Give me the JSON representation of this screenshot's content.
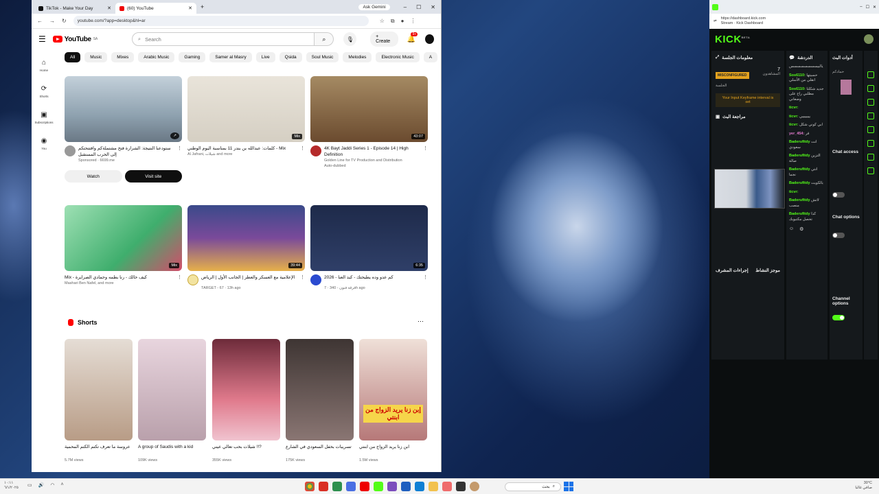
{
  "youtube": {
    "tabs": [
      {
        "label": "TikTok - Make Your Day"
      },
      {
        "label": "(60) YouTube"
      }
    ],
    "ask_gemini": "Ask Gemini",
    "url": "youtube.com/?app=desktop&hl=ar",
    "logo_text": "YouTube",
    "logo_sup": "SA",
    "search_placeholder": "Search",
    "create_label": "+ Create",
    "notif_badge": "9+",
    "sidebar": [
      {
        "label": "Home",
        "icon": "home-icon"
      },
      {
        "label": "Shorts",
        "icon": "shorts-icon"
      },
      {
        "label": "Subscriptions",
        "icon": "subscriptions-icon"
      },
      {
        "label": "You",
        "icon": "you-icon"
      }
    ],
    "chips": [
      "All",
      "Music",
      "Mixes",
      "Arabic Music",
      "Gaming",
      "Samer al Masry",
      "Live",
      "Qsida",
      "Soul Music",
      "Melodies",
      "Electronic Music",
      "A"
    ],
    "videos": [
      {
        "title": "ستودعنا النتيجة: الشرارة فتح مشتملةكم وافتتحتكم إلى الحرب المستقبل",
        "meta1": "Sponsored · 6699.me",
        "color": "#9fb3c4",
        "duration": ""
      },
      {
        "title": "كلمات: عبدالله بن بندر 11 بمناسبة اليوم الوطني - Mix",
        "meta1": "Al Jafrani, شيلات and more",
        "color": "#ece7de",
        "duration": "Mix"
      },
      {
        "title": "4K Bayt Jaddi Series 1 - Episode 14 | High Definition",
        "meta1": "Golden Line for TV Production and Distribution",
        "meta2": "Auto-dubbed",
        "color": "#7a5a3a",
        "duration": "43:07"
      },
      {
        "title": "Mix - كيف حالك - رنا بطمه وحمادي الصرايرة",
        "meta1": "Mashari Ben Nafel, and more",
        "color": "#6fc98e",
        "duration": "Mix"
      },
      {
        "title": "الإعلامية مع العسكر والعطر | الجانب الأول | الرياض",
        "meta1": "TARGET - 67 · 13h ago",
        "color": "#4e5a88",
        "duration": "39:44"
      },
      {
        "title": "كم عدو وده يطيحتك - كبد العنا - 2026",
        "meta1": "فرقة فنون - 340 · 7h ago",
        "color": "#2c3c63",
        "duration": "6:35"
      }
    ],
    "watch_label": "Watch",
    "visit_label": "Visit site",
    "shorts_title": "Shorts",
    "shorts": [
      {
        "title": "عروسة ما تعرف تكتم الكتم المحمية",
        "views": "5.7M views",
        "color": "#c9b7a8"
      },
      {
        "title": "A group of Saudis with a kid",
        "views": "109K views",
        "color": "#d8c6d1"
      },
      {
        "title": "شيلات بحب تعالي عيني !!?",
        "views": "355K views",
        "color": "#c86a7a"
      },
      {
        "title": "تسريبات بحفل السعودي في الشارع",
        "views": "175K views",
        "color": "#6d5d5a"
      },
      {
        "title": "ابن زنا يريد الزواج من ابنتي",
        "views": "1.5M views",
        "color": "#d8a0a0",
        "caption": "إبن زنا يريد الزواج من ابنتي"
      }
    ]
  },
  "kick": {
    "url": "https://dashboard.kick.com",
    "url_title": "Stream · Kick Dashboard",
    "logo": "KICK",
    "panels": {
      "session": "معلومات الجلسة",
      "chat": "الدردشة",
      "actions": "أدوات البث",
      "warning": "MISCONFIGURED",
      "viewers_count": "7",
      "viewers_label": "المشاهدون",
      "session_label": "الجلسة",
      "keyframe_msg": "Your Input Keyframe interval is set",
      "review": "مراجعة البث",
      "mod": "موجز النشاط",
      "mod2": "إجراءات المشرف"
    },
    "chat": [
      {
        "user": "",
        "text": "يالبيسسسسسسسس"
      },
      {
        "user": "Sos6110:",
        "text": "حسيتها انقلي من الأسلي"
      },
      {
        "user": "Sos6110:",
        "text": "جديد شكلنا مطلبي راح على وضعاني"
      },
      {
        "user": "ticvr:",
        "text": ""
      },
      {
        "user": "ticvr:",
        "text": "يييييييي"
      },
      {
        "user": "ticvr:",
        "text": "ابي كوني شكل"
      },
      {
        "user": "yer_454:",
        "text": "قر",
        "pink": true
      },
      {
        "user": "Baderufitdy",
        "text": "انت سعودي"
      },
      {
        "user": "Baderufitdy",
        "text": "التزين صالة"
      },
      {
        "user": "Baderufitdy",
        "text": "انتي نجما"
      },
      {
        "user": "Baderufitdy",
        "text": "بالكويت"
      },
      {
        "user": "ticvr:",
        "text": ""
      },
      {
        "user": "Baderufitdy",
        "text": "لاتش منصب"
      },
      {
        "user": "Baderufitdy",
        "text": "كذا تحصل مكتبوبك"
      }
    ],
    "settings": {
      "chat_access": "Chat access",
      "chat_options": "Chat options",
      "channel_options": "Channel options",
      "stream_info": "حمادكم"
    }
  },
  "taskbar": {
    "search": "بحث",
    "date": "٦/١/٢٠٢٥",
    "time": "١٠:١١",
    "weather_temp": "30°C",
    "weather_desc": "صافي غالبا"
  }
}
